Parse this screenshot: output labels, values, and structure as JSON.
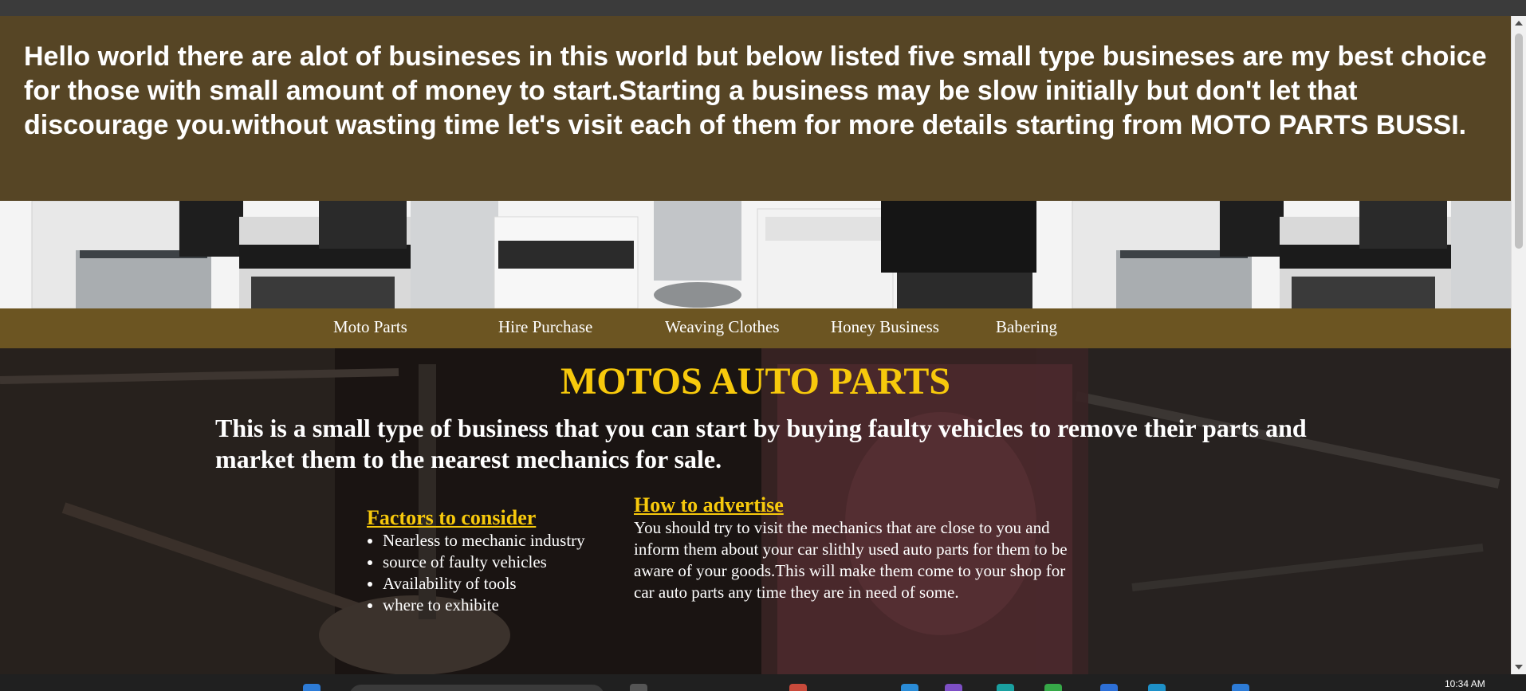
{
  "intro": {
    "text": "Hello world there are alot of busineses in this world but below listed five small type busineses are my best choice for those with small amount of money to start.Starting a business may be slow initially but don't let that discourage you.without wasting time let's visit each of them for more details starting from MOTO PARTS BUSSI."
  },
  "nav": {
    "items": [
      {
        "label": "Moto Parts"
      },
      {
        "label": "Hire Purchase"
      },
      {
        "label": "Weaving Clothes"
      },
      {
        "label": "Honey Business"
      },
      {
        "label": "Babering"
      }
    ]
  },
  "hero": {
    "title": "MOTOS AUTO PARTS",
    "description": "This is a small type of business that you can start by buying faulty vehicles to remove their parts and market them to the nearest mechanics for sale."
  },
  "factors": {
    "heading": "Factors to consider",
    "items": [
      "Nearless to mechanic industry",
      "source of faulty vehicles",
      "Availability of tools",
      "where to exhibite"
    ]
  },
  "advertise": {
    "heading": "How to advertise",
    "text": "You should try to visit the mechanics that are close to you and inform them about your car slithly used auto parts for them to be aware of your goods.This will make them come to your shop for car auto parts any time they are in need of some."
  },
  "taskbar": {
    "clock": "10:34 AM"
  },
  "colors": {
    "intro_bg": "#564525",
    "nav_bg": "#6c5522",
    "title_yellow": "#f7c90c"
  }
}
